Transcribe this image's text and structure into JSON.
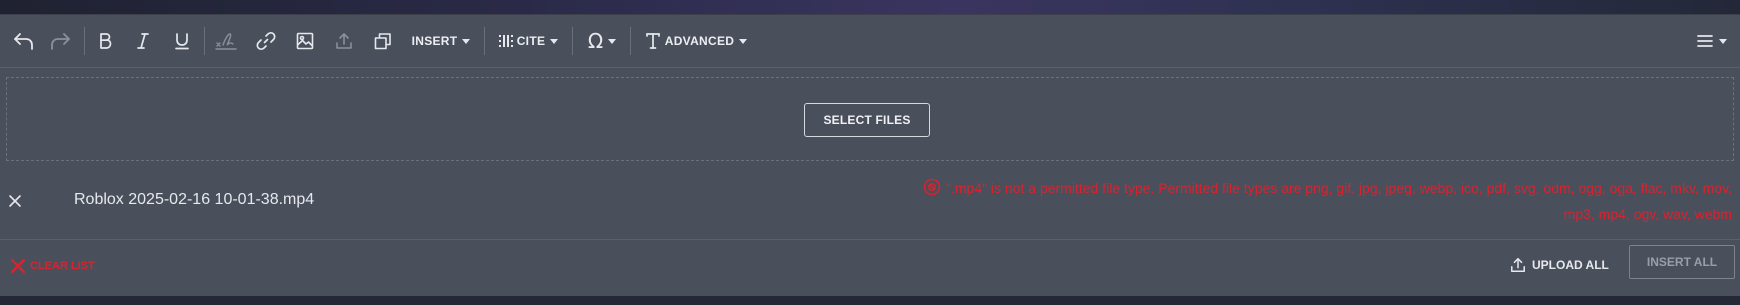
{
  "toolbar": {
    "insert_label": "INSERT",
    "cite_label": "CITE",
    "advanced_label": "ADVANCED",
    "buttons": [
      "undo-icon",
      "redo-icon",
      "bold-icon",
      "italic-icon",
      "underline-icon",
      "signature-icon",
      "link-icon",
      "image-icon",
      "upload-icon",
      "gallery-icon",
      "special-character-icon",
      "text-style-icon",
      "menu-icon"
    ]
  },
  "dropzone": {
    "select_files_label": "SELECT FILES"
  },
  "files": [
    {
      "name": "Roblox 2025-02-16 10-01-38.mp4",
      "error": "\".mp4\" is not a permitted file type. Permitted file types are png, gif, jpg, jpeg, webp, ico, pdf, svg, odm, ogg, oga, flac, mkv, mov, mp3, mp4, ogv, wav, webm"
    }
  ],
  "footer": {
    "clear_list_label": "CLEAR LIST",
    "upload_all_label": "UPLOAD ALL",
    "insert_all_label": "INSERT ALL"
  },
  "colors": {
    "editor_bg": "#4a4f5c",
    "error": "#d8232f",
    "text": "#e6e8ec",
    "disabled": "#9a9ea8"
  }
}
